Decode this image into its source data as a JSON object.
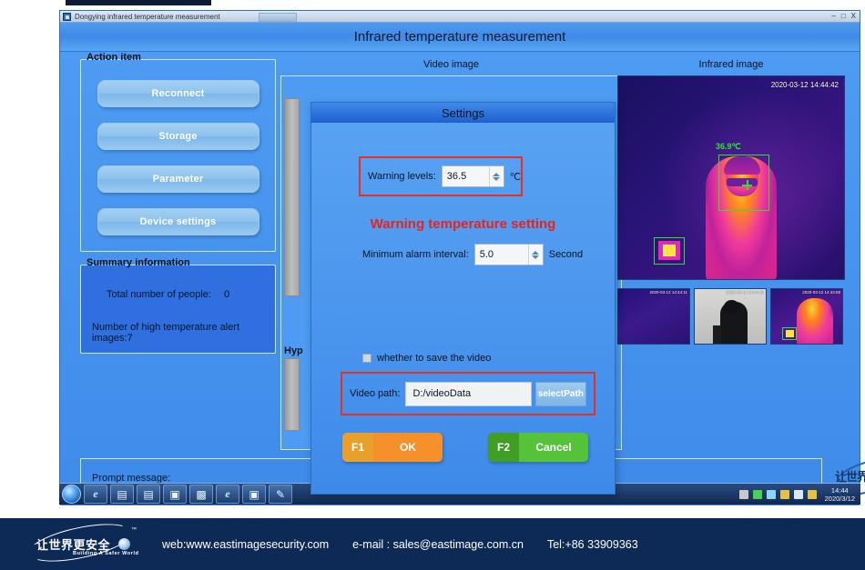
{
  "window": {
    "taskbar_title": "Dongying infrared temperature measurement",
    "minimize": "–",
    "maximize": "□",
    "close": "X",
    "app_title": "Infrared temperature measurement"
  },
  "left_panel": {
    "action_group_title": "Action item",
    "buttons": [
      {
        "label": "Reconnect"
      },
      {
        "label": "Storage"
      },
      {
        "label": "Parameter"
      },
      {
        "label": "Device settings"
      }
    ],
    "summary_group_title": "Summary information",
    "total_people_label": "Total number of people:",
    "total_people_value": "0",
    "alert_images_label": "Number of high temperature alert images:7"
  },
  "center_panel": {
    "video_image_label": "Video image",
    "hyp_label": "Hyp"
  },
  "settings_dialog": {
    "title": "Settings",
    "warning_levels_label": "Warning levels:",
    "warning_levels_value": "36.5",
    "warning_levels_unit": "℃",
    "headline": "Warning temperature setting",
    "interval_label": "Minimum alarm interval:",
    "interval_value": "5.0",
    "interval_unit": "Second",
    "save_video_label": "whether to save the video",
    "video_path_label": "Video path:",
    "video_path_value": "D:/videoData",
    "select_path_button": "selectPath",
    "ok_key": "F1",
    "ok_label": "OK",
    "cancel_key": "F2",
    "cancel_label": "Cancel",
    "highlight_color": "#e8301f"
  },
  "right_panel": {
    "infrared_image_label": "Infrared image",
    "timestamp": "2020-03-12 14:44:42",
    "detected_temperature": "36.9℃",
    "thumbnails": [
      {
        "timestamp": "2020-03-12 14:44:11"
      },
      {
        "timestamp": "2020-03-12 14:44:34"
      },
      {
        "timestamp": "2020-03-12 14:43:58"
      }
    ]
  },
  "prompt_bar": {
    "label": "Prompt message:"
  },
  "brand": {
    "chinese": "让世界更安全",
    "english": "Building A Safer World",
    "tm": "™"
  },
  "taskbar": {
    "icons": [
      "ie-icon",
      "notepad-icon",
      "folder-icon",
      "media-icon",
      "network-icon",
      "ie-icon",
      "app-icon",
      "paint-icon"
    ],
    "clock_time": "14:44",
    "clock_date": "2020/3/12"
  },
  "banner": {
    "web": "web:www.eastimagesecurity.com",
    "email": "e-mail : sales@eastimage.com.cn",
    "tel": "Tel:+86 33909363"
  }
}
